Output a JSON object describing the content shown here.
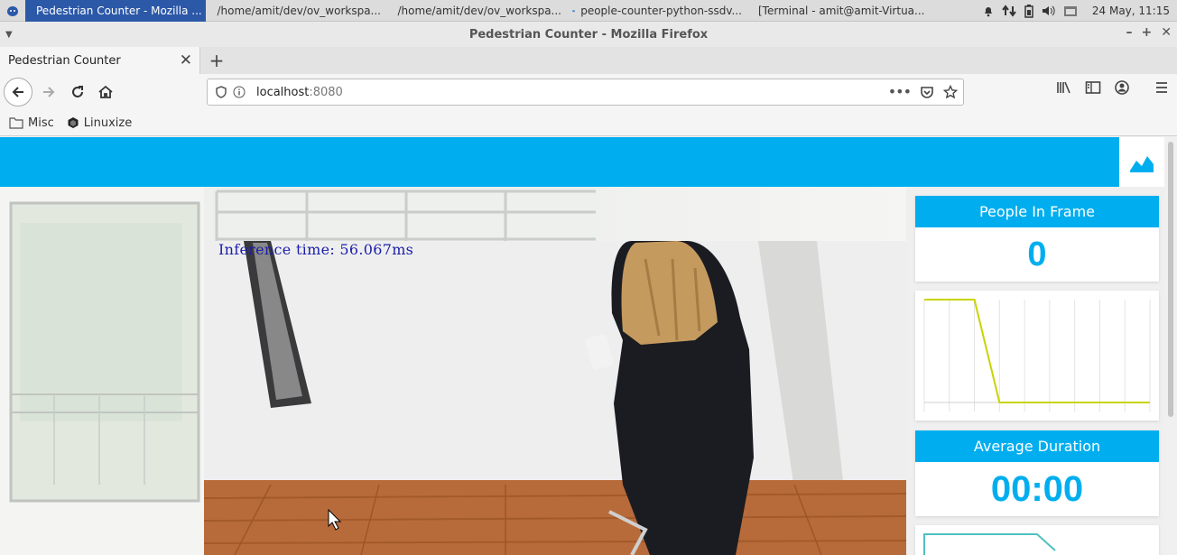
{
  "taskbar": {
    "tasks": [
      {
        "label": "Pedestrian Counter - Mozilla ...",
        "active": true
      },
      {
        "label": "/home/amit/dev/ov_workspa...",
        "active": false
      },
      {
        "label": "/home/amit/dev/ov_workspa...",
        "active": false
      },
      {
        "label": "people-counter-python-ssdv...",
        "active": false
      },
      {
        "label": "[Terminal - amit@amit-Virtua...",
        "active": false
      }
    ],
    "clock": "24 May, 11:15"
  },
  "window": {
    "title": "Pedestrian Counter - Mozilla Firefox"
  },
  "browser": {
    "tab_title": "Pedestrian Counter",
    "url_host": "localhost",
    "url_port": ":8080",
    "bookmarks": [
      {
        "label": "Misc",
        "icon": "folder-icon"
      },
      {
        "label": "Linuxize",
        "icon": "hexagon-icon"
      }
    ]
  },
  "page": {
    "inference_text": "Inference time: 56.067ms",
    "people_in_frame_label": "People In Frame",
    "people_in_frame_value": "0",
    "average_duration_label": "Average Duration",
    "average_duration_value": "00:00"
  },
  "colors": {
    "accent": "#00aeef",
    "line_chart": "#c8d400",
    "line_chart_2": "#4fc0c0"
  },
  "sparkline": {
    "values": [
      1,
      1,
      1,
      0,
      0,
      0,
      0,
      0,
      0
    ]
  }
}
